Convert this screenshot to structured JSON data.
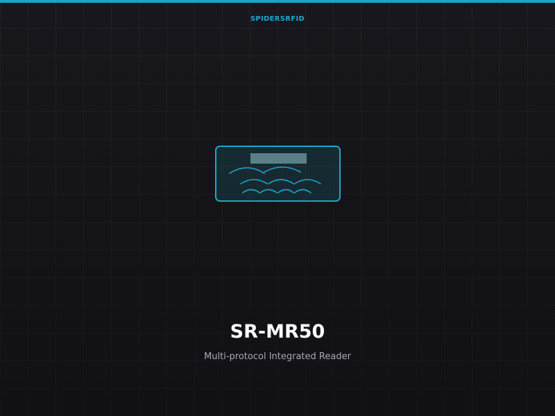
{
  "brand": {
    "name": "SPIDERSRFID"
  },
  "product": {
    "model": "SR-MR50",
    "description": "Multi-protocol Integrated Reader",
    "icon": "rfid-reader-icon"
  },
  "colors": {
    "accent": "#1ea6c6",
    "background": "#17171c",
    "title": "#ffffff",
    "subtitle": "#a9abb3",
    "device_screen": "#5a7f87"
  }
}
